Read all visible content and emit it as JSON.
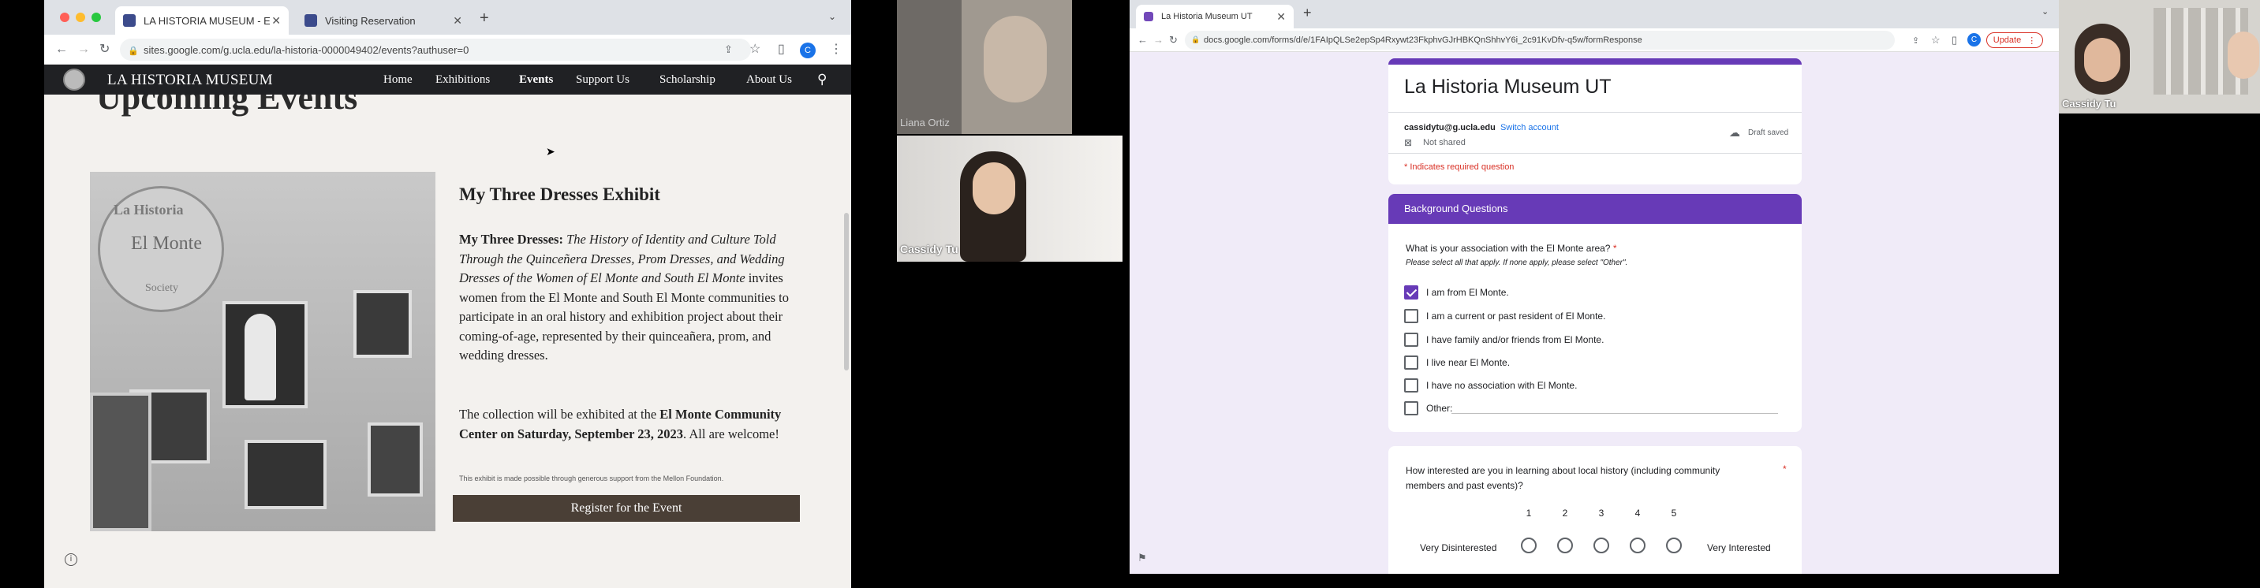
{
  "left_browser": {
    "tabs": [
      {
        "label": "LA HISTORIA MUSEUM - Events"
      },
      {
        "label": "Visiting Reservation"
      }
    ],
    "url": "sites.google.com/g.ucla.edu/la-historia-0000049402/events?authuser=0",
    "profile_initial": "C",
    "site": {
      "name": "LA HISTORIA MUSEUM",
      "nav": [
        "Home",
        "Exhibitions",
        "Events",
        "Support Us",
        "Scholarship",
        "About Us"
      ],
      "active_nav": "Events",
      "heading": "Upcoming Events",
      "photo_text": {
        "line1": "La Historia",
        "line2": "El Monte",
        "line3": "Society"
      },
      "exhibit_title": "My Three Dresses Exhibit",
      "desc_bold": "My Three Dresses:",
      "desc_italic": "The History of Identity and Culture Told Through the Quinceñera Dresses, Prom Dresses, and Wedding Dresses of the Women of El Monte and South El Monte",
      "desc_rest": "invites women from the El Monte and South El Monte communities to participate in an oral history and exhibition project about their coming-of-age, represented by their quinceañera, prom, and wedding dresses.",
      "exhibit_pre": "The collection will be exhibited at the",
      "exhibit_bold": "El Monte Community Center on Saturday, September 23, 2023",
      "exhibit_post": ". All are welcome!",
      "fineprint": "This exhibit is made possible through generous support from the Mellon Foundation.",
      "register_button": "Register for the Event"
    }
  },
  "video": {
    "participant1": "Liana Ortiz",
    "participant2": "Cassidy Tu"
  },
  "right_browser": {
    "tab": "La Historia Museum UT",
    "url": "docs.google.com/forms/d/e/1FAIpQLSe2epSp4Rxywt23FkphvGJrHBKQnShhvY6i_2c91KvDfv-q5w/formResponse",
    "update_label": "Update",
    "profile_initial": "C",
    "form": {
      "title": "La Historia Museum UT",
      "email": "cassidytu@g.ucla.edu",
      "switch_account": "Switch account",
      "not_shared": "Not shared",
      "draft_saved": "Draft saved",
      "required_note": "* Indicates required question",
      "section": "Background Questions",
      "q1": "What is your association with the El Monte area?",
      "q1_help": "Please select all that apply. If none apply, please select \"Other\".",
      "options": [
        {
          "label": "I am from El Monte.",
          "checked": true
        },
        {
          "label": "I am a current or past resident of El Monte.",
          "checked": false
        },
        {
          "label": "I have family and/or friends from El Monte.",
          "checked": false
        },
        {
          "label": "I live near El Monte.",
          "checked": false
        },
        {
          "label": "I have no association with El Monte.",
          "checked": false
        },
        {
          "label": "Other:",
          "checked": false
        }
      ],
      "q2": "How interested are you in learning about local history (including community members and past events)?",
      "scale": [
        "1",
        "2",
        "3",
        "4",
        "5"
      ],
      "scale_low": "Very Disinterested",
      "scale_high": "Very Interested",
      "accent": "#673ab7"
    }
  },
  "video_right": {
    "participant": "Cassidy Tu"
  }
}
